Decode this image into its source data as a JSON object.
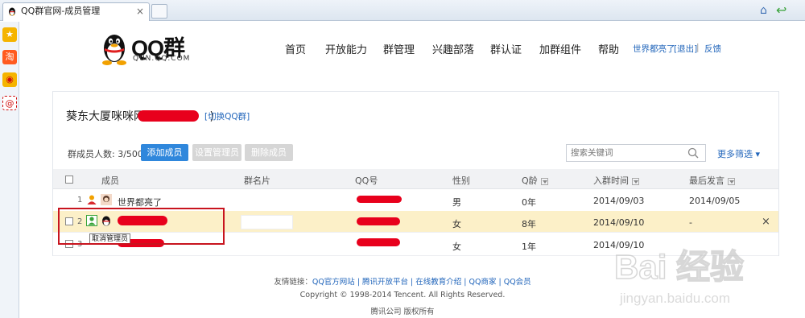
{
  "browser": {
    "tab_title": "QQ群官网-成员管理",
    "tab_close": "×"
  },
  "sidebar": [
    "favorites-star",
    "taobao",
    "weibo",
    "email"
  ],
  "header": {
    "logo_text": "QQ群",
    "logo_sub": "QUN.QQ.COM",
    "nav": [
      {
        "label": "首页"
      },
      {
        "label": "开放能力"
      },
      {
        "label": "群管理"
      },
      {
        "label": "兴趣部落"
      },
      {
        "label": "群认证"
      },
      {
        "label": "加群组件"
      },
      {
        "label": "帮助"
      }
    ],
    "user_name": "世界都亮了",
    "logout": "[退出]",
    "separator": "|",
    "feedback": "反馈"
  },
  "group": {
    "name": "葵东大厦咪咪网(",
    "name_close": ")",
    "switch_label": "[切换QQ群]"
  },
  "toolbar": {
    "member_count": "群成员人数: 3/500",
    "add_member": "添加成员",
    "set_admin": "设置管理员",
    "delete_member": "删除成员",
    "search_placeholder": "搜索关键词",
    "more_filter": "更多筛选 ▾"
  },
  "table": {
    "headers": [
      "成员",
      "群名片",
      "QQ号",
      "性别",
      "Q龄",
      "入群时间",
      "最后发言"
    ],
    "rows": [
      {
        "num": "1",
        "name": "世界都亮了",
        "gender": "男",
        "qage": "0年",
        "join": "2014/09/03",
        "last": "2014/09/05"
      },
      {
        "num": "2",
        "name": "",
        "gender": "女",
        "qage": "8年",
        "join": "2014/09/10",
        "last": "-"
      },
      {
        "num": "3",
        "name": "",
        "gender": "女",
        "qage": "1年",
        "join": "2014/09/10",
        "last": ""
      }
    ],
    "tooltip": "取消管理员",
    "close": "×"
  },
  "footer": {
    "links_prefix": "友情链接：",
    "links": "QQ官方网站 | 腾讯开放平台 | 在线教育介绍 | QQ商家 | QQ会员",
    "copyright": "Copyright © 1998-2014 Tencent. All Rights Reserved.",
    "company": "腾讯公司 版权所有"
  },
  "watermark": {
    "brand": "Bai 经验",
    "url": "jingyan.baidu.com"
  },
  "colors": {
    "primary_button": "#2f87dc",
    "link": "#2266bb",
    "highlight_row": "#fcf0c8",
    "redaction": "#e8001c",
    "annotation_outline": "#c8141e"
  }
}
